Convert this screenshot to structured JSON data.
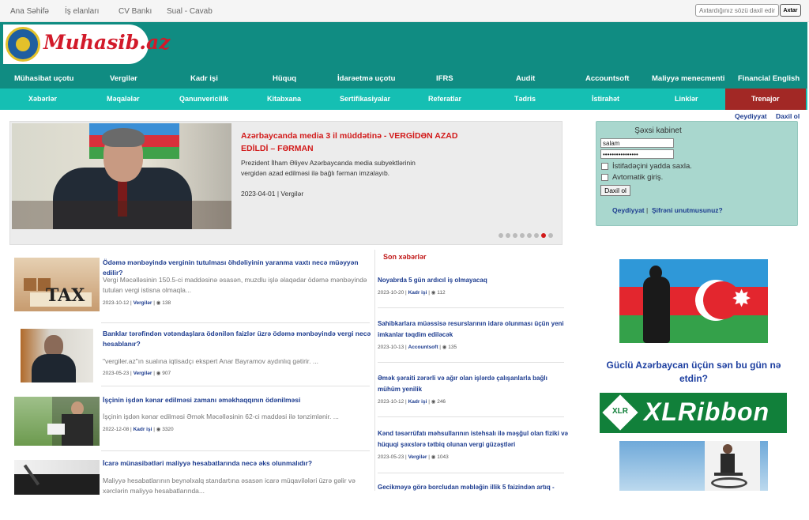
{
  "topnav": [
    "Ana Səhifə",
    "İş elanları",
    "CV Bankı",
    "Sual - Cavab"
  ],
  "search": {
    "placeholder": "Axtardığınız sözü daxil edin",
    "button": "Axtar"
  },
  "logo": {
    "text": "Muhasib.az"
  },
  "mainnav": [
    "Mühasibat uçotu",
    "Vergilər",
    "Kadr işi",
    "Hüquq",
    "İdarəetmə uçotu",
    "IFRS",
    "Audit",
    "Accountsoft",
    "Maliyyə menecmenti",
    "Financial English"
  ],
  "subnav": [
    "Xəbərlər",
    "Məqalələr",
    "Qanunvericilik",
    "Kitabxana",
    "Sertifikasiyalar",
    "Referatlar",
    "Tədris",
    "İstirahət",
    "Linklər",
    "Trenajor"
  ],
  "auth_links": {
    "register": "Qeydiyyat",
    "login": "Daxil ol"
  },
  "slider": {
    "title": "Azərbaycanda media 3 il müddətinə - VERGİDƏN AZAD EDİLDİ – FƏRMAN",
    "desc": "Prezident İlham Əliyev Azərbaycanda media subyektlərinin vergidən azad edilməsi ilə bağlı fərman imzalayıb.",
    "date": "2023-04-01",
    "category": "Vergilər",
    "dots_total": 8,
    "active_dot": 7
  },
  "login": {
    "title": "Şəxsi kabinet",
    "username": "salam",
    "password": "••••••••••••••••",
    "remember": "İstifadəçini yadda saxla.",
    "auto": "Avtomatik giriş.",
    "button": "Daxil ol",
    "register": "Qeydiyyat",
    "forgot": "Şifrəni unutmusunuz?"
  },
  "news": [
    {
      "title": "Ödəmə mənbəyində verginin tutulması öhdəliyinin yaranma vaxtı necə müəyyən edilir?",
      "desc": "Vergi Məcəlləsinin 150.5-ci maddəsinə əsasən, muzdlu işlə əlaqədar ödəmə mənbəyində tutulan vergi istisna olmaqla...",
      "date": "2023-10-12",
      "category": "Vergilər",
      "views": "138"
    },
    {
      "title": "Banklar tərəfindən vətəndaşlara ödənilən faizlər üzrə ödəmə mənbəyində vergi necə hesablanır?",
      "desc": "\"vergiler.az\"ın sualına iqtisadçı ekspert Anar Bayramov aydınlıq gətirir. ...",
      "date": "2023-05-23",
      "category": "Vergilər",
      "views": "907"
    },
    {
      "title": "İşçinin işdən kənar edilməsi zamanı əməkhaqqının ödənilməsi",
      "desc": "İşçinin işdən kənar edilməsi Əmək Məcəlləsinin 62-ci maddəsi ilə tənzimlənir. ...",
      "date": "2022-12-08",
      "category": "Kadr işi",
      "views": "3320"
    },
    {
      "title": "İcarə münasibətləri maliyyə hesabatlarında necə əks olunmalıdır?",
      "desc": "Maliyyə hesabatlarının beynəlxalq standartına əsasən icarə müqavilələri üzrə gəlir və xərclərin maliyyə hesabatlarında...",
      "date": "",
      "category": "",
      "views": ""
    }
  ],
  "latest": {
    "heading": "Son xəbərlər",
    "items": [
      {
        "title": "Noyabrda 5 gün ardıcıl iş olmayacaq",
        "date": "2023-10-20",
        "category": "Kadr işi",
        "views": "112"
      },
      {
        "title": "Sahibkarlara müəssisə resurslarının idarə olunması üçün yeni imkanlar təqdim ediləcək",
        "date": "2023-10-13",
        "category": "Accountsoft",
        "views": "135"
      },
      {
        "title": "Əmək şəraiti zərərli və ağır olan işlərdə çalışanlarla bağlı mühüm yenilik",
        "date": "2023-10-12",
        "category": "Kadr işi",
        "views": "246"
      },
      {
        "title": "Kənd təsərrüfatı məhsullarının istehsalı ilə məşğul olan fiziki və hüquqi şəxslərə tətbiq olunan vergi güzəştləri",
        "date": "2023-05-23",
        "category": "Vergilər",
        "views": "1043"
      },
      {
        "title": "Gecikməyə görə borcludan məbləğin illik 5 faizindən artıq -",
        "date": "",
        "category": "",
        "views": ""
      }
    ]
  },
  "banner": {
    "slogan": "Güclü Azərbaycan üçün sən bu gün nə etdin?",
    "xlr_small": "XLR",
    "xlr_text": "XLRibbon"
  },
  "colors": {
    "header": "#108c82",
    "subnav": "#15bfb3",
    "trend": "#a22825",
    "link": "#1d3c8f",
    "accent": "#d21a1a"
  }
}
